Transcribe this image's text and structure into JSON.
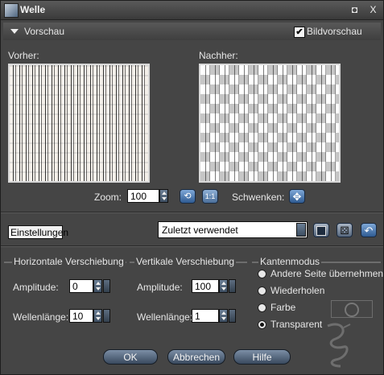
{
  "window": {
    "title": "Welle",
    "maximize_glyph": "◘",
    "close_glyph": "X"
  },
  "preview_section": {
    "label": "Vorschau",
    "bildvorschau_label": "Bildvorschau",
    "bildvorschau_checked": true,
    "check_glyph": "✔"
  },
  "preview": {
    "before_label": "Vorher:",
    "after_label": "Nachher:"
  },
  "zoom": {
    "label": "Zoom:",
    "value": "100",
    "fit_glyph": "⟲",
    "one_to_one_glyph": "1:1"
  },
  "pan": {
    "label": "Schwenken:",
    "glyph": "✥"
  },
  "settings": {
    "label": "Einstellungen",
    "preset_value": "Zuletzt verwendet",
    "save_glyph": "💾",
    "random_glyph": "⚄",
    "reset_glyph": "↶"
  },
  "horizontal": {
    "title": "Horizontale Verschiebung",
    "amplitude_label": "Amplitude:",
    "amplitude_value": "0",
    "wavelength_label": "Wellenlänge:",
    "wavelength_value": "10"
  },
  "vertical": {
    "title": "Vertikale Verschiebung",
    "amplitude_label": "Amplitude:",
    "amplitude_value": "100",
    "wavelength_label": "Wellenlänge:",
    "wavelength_value": "1"
  },
  "edge_mode": {
    "title": "Kantenmodus",
    "options": [
      "Andere Seite übernehmen",
      "Wiederholen",
      "Farbe",
      "Transparent"
    ],
    "selected": "Transparent",
    "color_glyph": "⃠"
  },
  "buttons": {
    "ok": "OK",
    "cancel": "Abbrechen",
    "help": "Hilfe"
  },
  "colors": {
    "window_bg": "#454545",
    "button_blue": "#2f5b92",
    "button_steel": "#5a6d84"
  }
}
